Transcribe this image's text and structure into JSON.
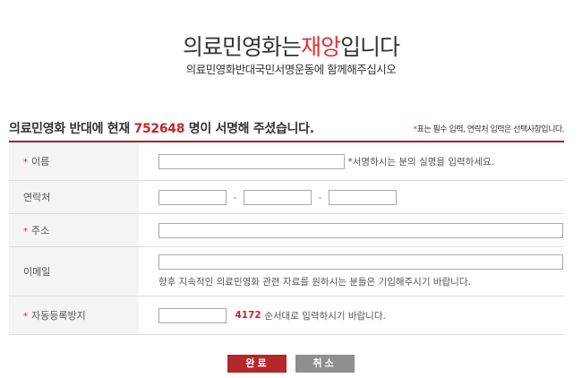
{
  "header": {
    "title_part1": "의료민영화는",
    "title_accent": "재앙",
    "title_part2": "입니다",
    "subtitle": "의료민영화반대국민서명운동에 함께해주십시오"
  },
  "count": {
    "prefix": "의료민영화 반대에 현재",
    "number": "752648",
    "suffix": "명이 서명해 주셨습니다.",
    "note_star": "*",
    "note_text": "표는 필수 입력, 연락처 입력은 선택사항입니다."
  },
  "form": {
    "name": {
      "required": true,
      "label": "이름",
      "value": "",
      "hint": "*서명하시는 분의 실명을 입력하세요."
    },
    "phone": {
      "required": false,
      "label": "연락처",
      "part1": "",
      "part2": "",
      "part3": "",
      "separator": "-"
    },
    "address": {
      "required": true,
      "label": "주소",
      "value": ""
    },
    "email": {
      "required": false,
      "label": "이메일",
      "value": "",
      "hint": "향후 지속적인 의료민영화 관련 자료를 원하시는 분들은 기입해주시기 바랍니다."
    },
    "captcha": {
      "required": true,
      "label": "자동등록방지",
      "value": "",
      "code": "4172",
      "hint": "순서대로 입력하시기 바랍니다."
    }
  },
  "buttons": {
    "submit": "완료",
    "cancel": "취소"
  },
  "colors": {
    "accent": "#c0282a",
    "button_primary": "#b5272b",
    "button_secondary": "#8f8f8f"
  }
}
